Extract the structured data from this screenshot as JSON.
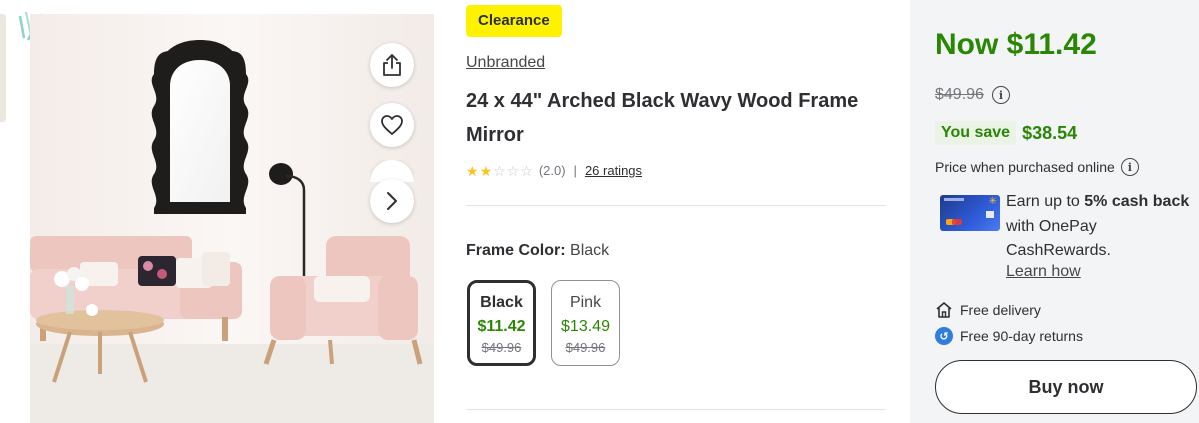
{
  "badge": {
    "label": "Clearance"
  },
  "product": {
    "brand": "Unbranded",
    "title": "24 x 44\" Arched Black Wavy Wood Frame Mirror",
    "rating": {
      "stars": 2.0,
      "text": "(2.0)",
      "separator": "|",
      "count_label": "26 ratings"
    }
  },
  "variants": {
    "label": "Frame Color:",
    "selected_value": "Black",
    "options": [
      {
        "name": "Black",
        "price": "$11.42",
        "was": "$49.96",
        "selected": true
      },
      {
        "name": "Pink",
        "price": "$13.49",
        "was": "$49.96",
        "selected": false
      }
    ]
  },
  "image_actions": {
    "share_icon": "share-icon",
    "favorite_icon": "heart-icon",
    "next_icon": "chevron-right-icon"
  },
  "buybox": {
    "now_price": "Now $11.42",
    "was_price": "$49.96",
    "you_save_label": "You save",
    "you_save_amount": "$38.54",
    "online_note": "Price when purchased online",
    "cashback": {
      "prefix": "Earn up to ",
      "bold": "5% cash back",
      "suffix": " with OnePay CashRewards.",
      "link": "Learn how"
    },
    "delivery": "Free delivery",
    "returns": "Free 90-day returns",
    "buy_button": "Buy now"
  },
  "colors": {
    "accent_green": "#2a8703",
    "clearance_yellow": "#fff200",
    "star_yellow": "#ffc220",
    "text_dark": "#2e2f32",
    "panel_bg": "#f2f4f6"
  }
}
